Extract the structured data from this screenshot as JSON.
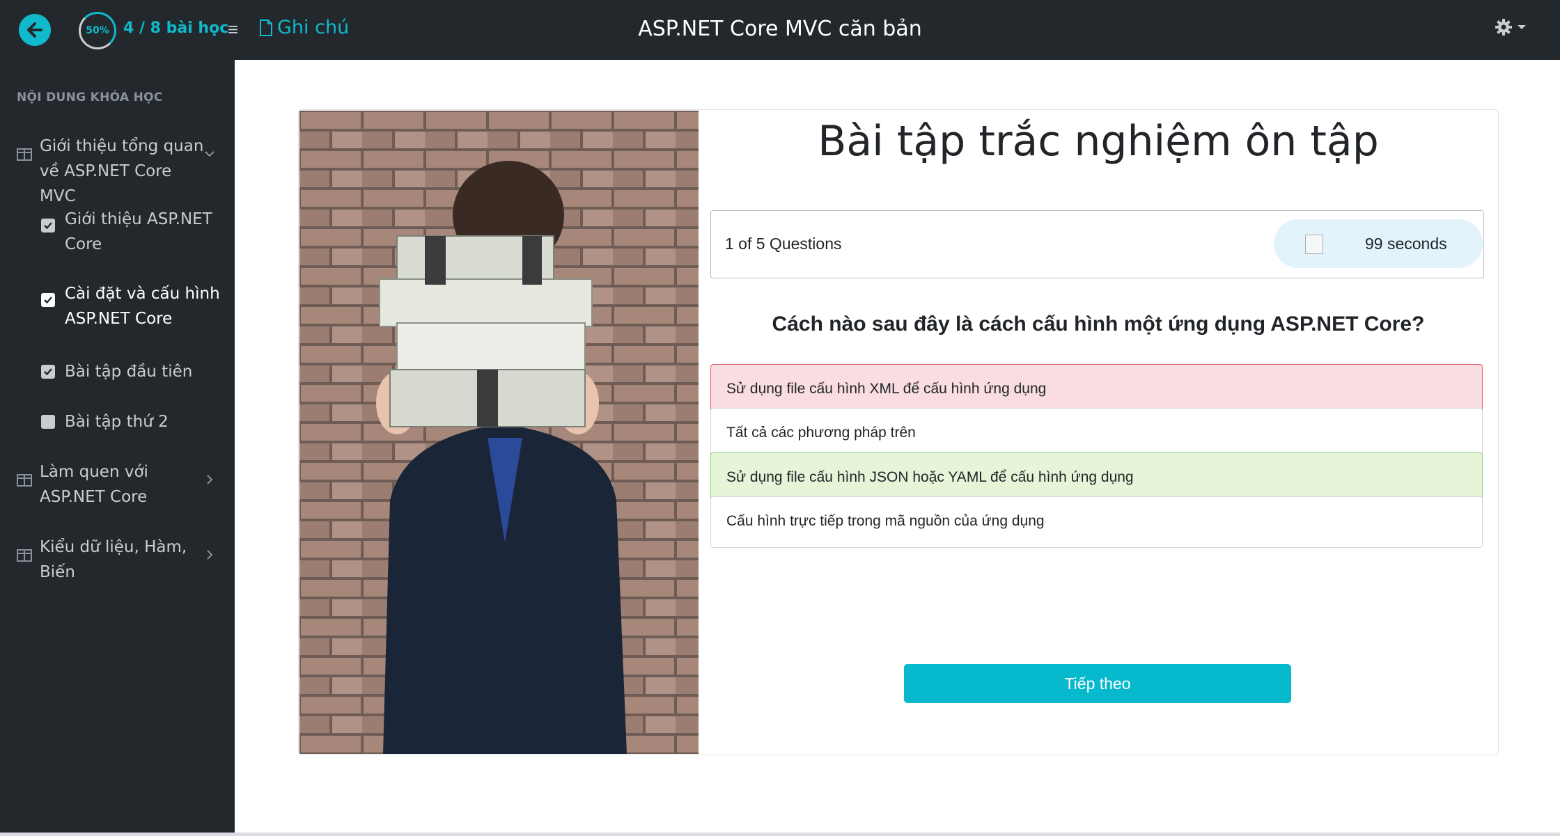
{
  "header": {
    "progress_percent": "50%",
    "lesson_count": "4 / 8 bài học",
    "notes_label": "Ghi chú",
    "course_title": "ASP.NET Core MVC căn bản"
  },
  "sidebar": {
    "heading": "NỘI DUNG KHÓA HỌC",
    "chapters": [
      {
        "label": "Giới thiệu tổng quan về ASP.NET Core MVC",
        "expanded": true
      },
      {
        "label": "Làm quen với ASP.NET Core",
        "expanded": false
      },
      {
        "label": "Kiểu dữ liệu, Hàm, Biến",
        "expanded": false
      }
    ],
    "lessons": [
      {
        "label": "Giới thiệu ASP.NET Core",
        "checked": true,
        "active": false
      },
      {
        "label": "Cài đặt và cấu hình ASP.NET Core",
        "checked": true,
        "active": true
      },
      {
        "label": "Bài tập đầu tiên",
        "checked": true,
        "active": false
      },
      {
        "label": "Bài tập thứ 2",
        "checked": false,
        "active": false
      }
    ]
  },
  "quiz": {
    "title": "Bài tập trắc nghiệm ôn tập",
    "question_count": "1 of 5 Questions",
    "timer": "99 seconds",
    "question": "Cách nào sau đây là cách cấu hình một ứng dụng ASP.NET Core?",
    "options": [
      {
        "text": "Sử dụng file cấu hình XML để cấu hình ứng dụng",
        "state": "wrong"
      },
      {
        "text": "Tất cả các phương pháp trên",
        "state": "neutral"
      },
      {
        "text": "Sử dụng file cấu hình JSON hoặc YAML để cấu hình ứng dụng",
        "state": "correct"
      },
      {
        "text": "Cấu hình trực tiếp trong mã nguồn của ứng dụng",
        "state": "neutral"
      }
    ],
    "next_label": "Tiếp theo"
  },
  "colors": {
    "accent": "#10b9cc",
    "topbar": "#23282d",
    "wrong_bg": "#f9dde0",
    "correct_bg": "#e6f4d8"
  }
}
